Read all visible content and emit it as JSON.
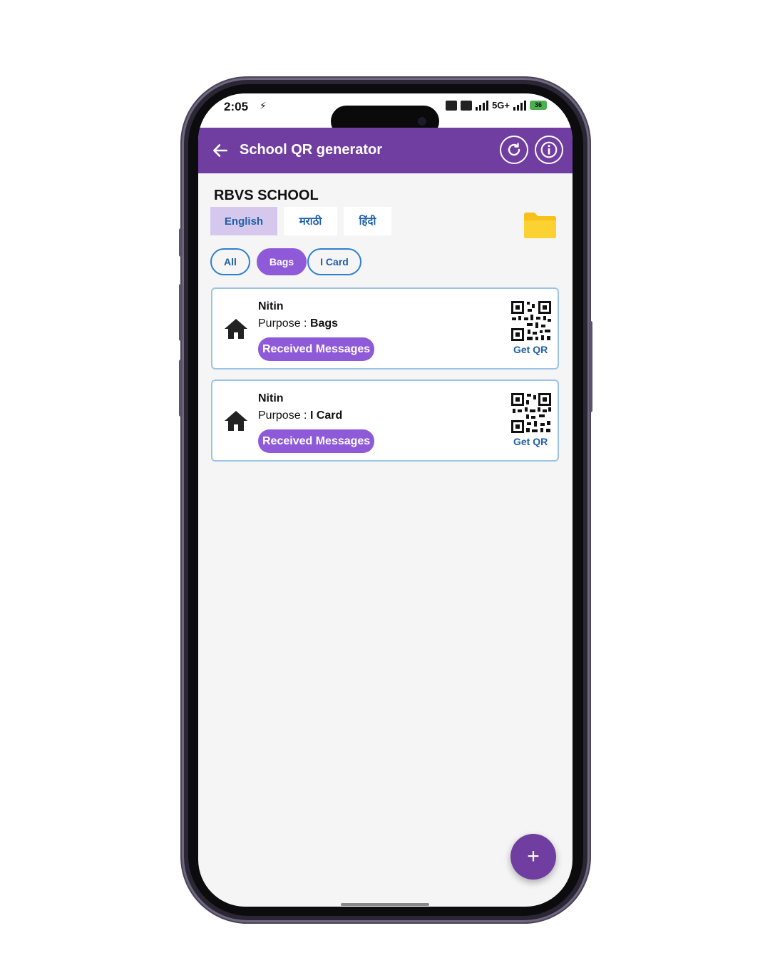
{
  "status_bar": {
    "time": "2:05",
    "network": "5G+",
    "battery": "36"
  },
  "app_bar": {
    "title": "School QR generator",
    "color": "#6f3ea0"
  },
  "school": {
    "name": "RBVS SCHOOL"
  },
  "language_tabs": [
    {
      "label": "English",
      "active": true
    },
    {
      "label": "मराठी",
      "active": false
    },
    {
      "label": "हिंदी",
      "active": false
    }
  ],
  "filters": [
    {
      "label": "All",
      "active": false
    },
    {
      "label": "Bags",
      "active": true
    },
    {
      "label": "I Card",
      "active": false
    }
  ],
  "cards": [
    {
      "name": "Nitin",
      "purpose_label": "Purpose : ",
      "purpose_value": "Bags",
      "messages_button": "Received Messages",
      "qr_label": "Get QR"
    },
    {
      "name": "Nitin",
      "purpose_label": "Purpose : ",
      "purpose_value": "I Card",
      "messages_button": "Received Messages",
      "qr_label": "Get QR"
    }
  ],
  "fab": {
    "icon": "plus-icon",
    "label": "+"
  },
  "colors": {
    "accent": "#8f5ad8",
    "primary": "#6f3ea0",
    "link": "#1e5fa8"
  }
}
